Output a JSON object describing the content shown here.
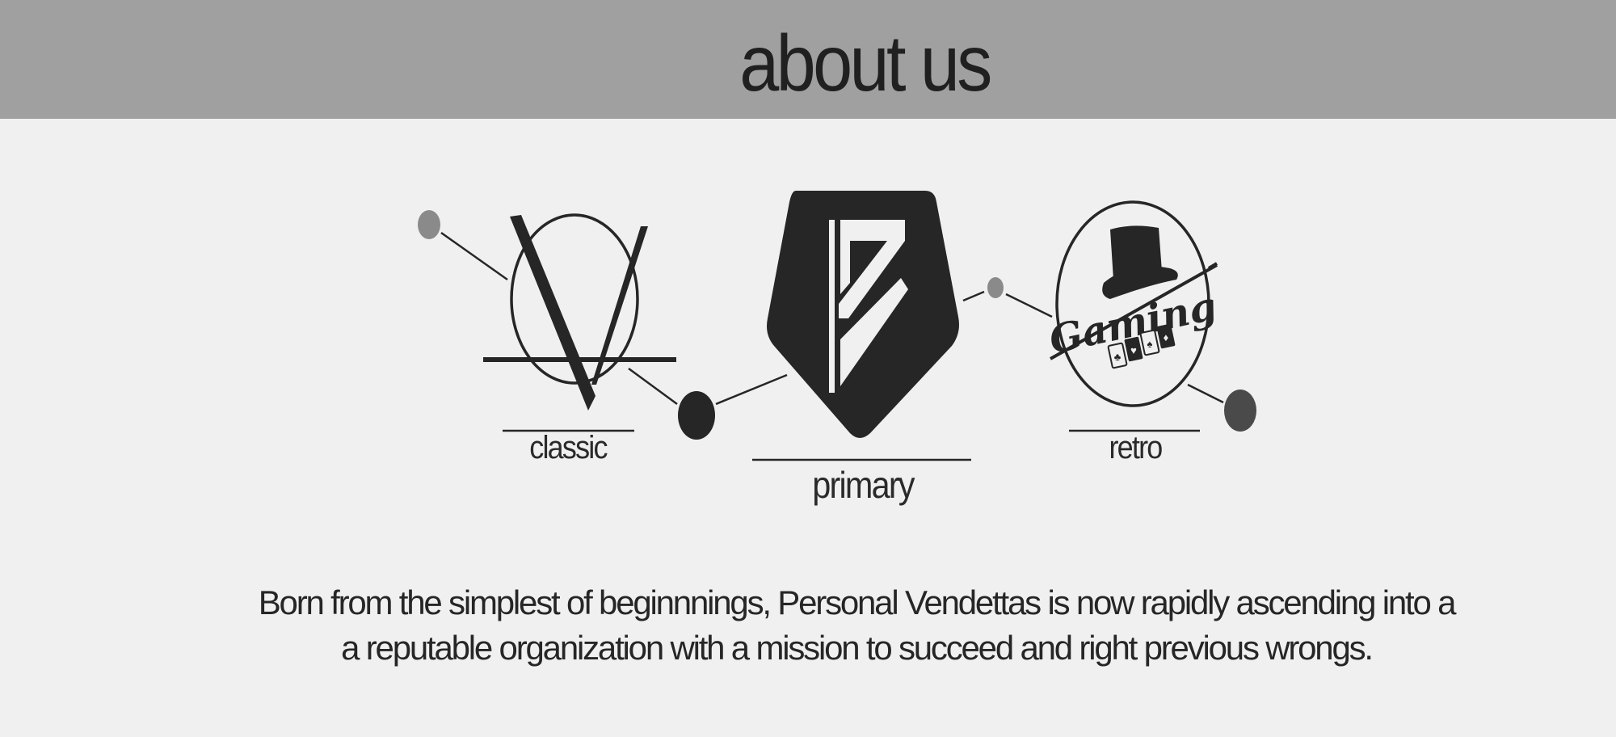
{
  "header": {
    "title": "about us",
    "background": "#a0a0a0"
  },
  "logos": [
    {
      "id": "classic",
      "label": "classic"
    },
    {
      "id": "primary",
      "label": "primary"
    },
    {
      "id": "retro",
      "label": "retro",
      "badge_text": "Gaming"
    }
  ],
  "about": {
    "line1": "Born from the simplest of beginnnings, Personal Vendettas is now rapidly ascending into a",
    "line2": "a reputable organization with a mission to succeed and right previous wrongs."
  },
  "colors": {
    "page_background": "#f0f0f0",
    "ink": "#262626",
    "dot_light": "#8a8a8a",
    "dot_dark": "#262626",
    "dot_mid": "#4a4a4a"
  }
}
